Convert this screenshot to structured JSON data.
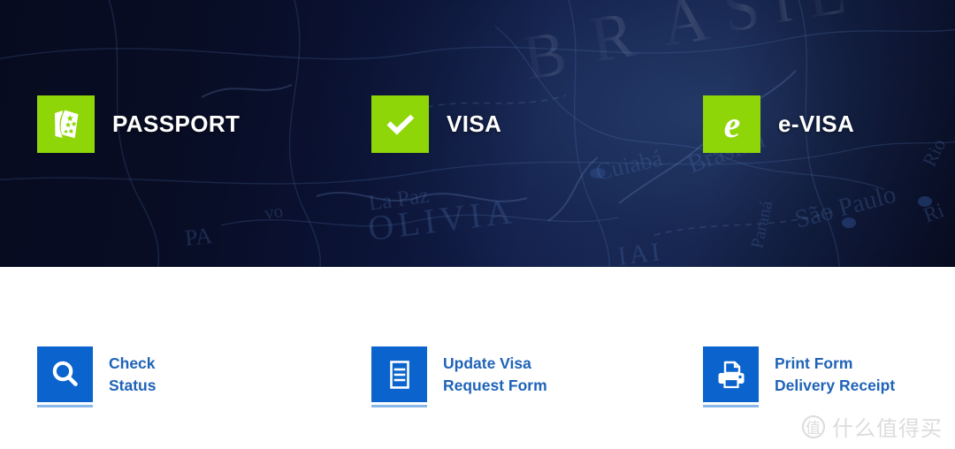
{
  "banner": {
    "background_color": "#0a0f2b",
    "accent_color": "#8ed608",
    "map_labels": [
      "B",
      "R",
      "A",
      "S",
      "I",
      "L",
      "BOLIVIA",
      "La Paz",
      "Cuiabá",
      "Brasília",
      "São Paulo",
      "Paraná",
      "Rio"
    ],
    "items": [
      {
        "icon": "passport-icon",
        "label": "PASSPORT"
      },
      {
        "icon": "check-mark-icon",
        "label": "VISA"
      },
      {
        "icon": "e-letter-icon",
        "label": "e-VISA"
      }
    ]
  },
  "links": {
    "accent_color": "#0b63ce",
    "text_color": "#1f63b8",
    "underline_color": "#8ab6e8",
    "items": [
      {
        "icon": "search-icon",
        "line1": "Check",
        "line2": "Status"
      },
      {
        "icon": "document-icon",
        "line1": "Update Visa",
        "line2": "Request Form"
      },
      {
        "icon": "printer-icon",
        "line1": "Print Form",
        "line2": "Delivery Receipt"
      }
    ]
  },
  "watermark": {
    "badge": "值",
    "text": "什么值得买",
    "color": "#dcdcdc"
  }
}
